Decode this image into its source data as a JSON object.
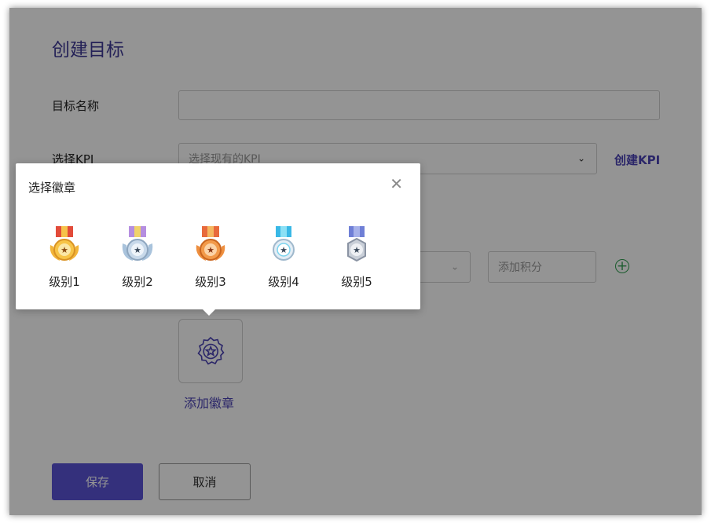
{
  "form": {
    "title": "创建目标",
    "goal_name_label": "目标名称",
    "goal_name_value": "",
    "kpi_label": "选择KPI",
    "kpi_placeholder": "选择现有的KPI",
    "create_kpi_label": "创建KPI",
    "points_placeholder": "添加积分",
    "add_badge_label": "添加徽章",
    "save_label": "保存",
    "cancel_label": "取消"
  },
  "popover": {
    "title": "选择徽章",
    "close_icon": "close-icon",
    "medals": [
      {
        "label": "级别1",
        "icon": "gold-medal-icon",
        "color": "#f2b53a"
      },
      {
        "label": "级别2",
        "icon": "silver-winged-medal-icon",
        "color": "#a9c3dc"
      },
      {
        "label": "级别3",
        "icon": "bronze-medal-icon",
        "color": "#ee8f3f"
      },
      {
        "label": "级别4",
        "icon": "light-blue-medal-icon",
        "color": "#7ad3ee"
      },
      {
        "label": "级别5",
        "icon": "grey-medal-icon",
        "color": "#9aa3b3"
      }
    ]
  },
  "colors": {
    "accent": "#4a43b5",
    "primary_button": "#5b54d6",
    "plus_icon": "#2e9e4f"
  }
}
